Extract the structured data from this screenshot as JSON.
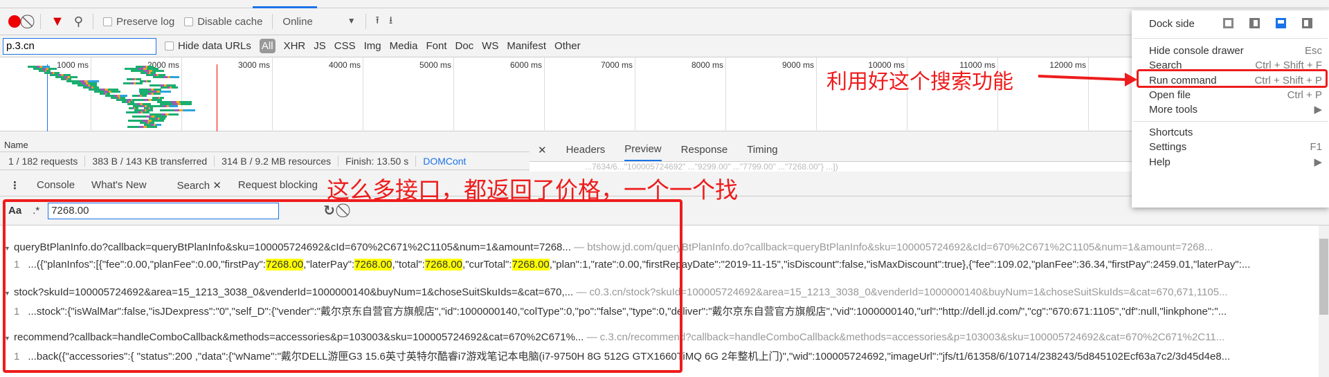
{
  "network_toolbar": {
    "preserve_log": "Preserve log",
    "disable_cache": "Disable cache",
    "throttle": "Online"
  },
  "filter": {
    "value": "p.3.cn",
    "hide_data_urls": "Hide data URLs",
    "types": [
      "All",
      "XHR",
      "JS",
      "CSS",
      "Img",
      "Media",
      "Font",
      "Doc",
      "WS",
      "Manifest",
      "Other"
    ]
  },
  "timeline": {
    "ticks": [
      "1000 ms",
      "2000 ms",
      "3000 ms",
      "4000 ms",
      "5000 ms",
      "6000 ms",
      "7000 ms",
      "8000 ms",
      "9000 ms",
      "10000 ms",
      "11000 ms",
      "12000 ms"
    ]
  },
  "requests": {
    "name_header": "Name"
  },
  "status": {
    "requests": "1 / 182 requests",
    "transferred": "383 B / 143 KB transferred",
    "resources": "314 B / 9.2 MB resources",
    "finish": "Finish: 13.50 s",
    "domcontent": "DOMCont"
  },
  "detail_tabs": {
    "headers": "Headers",
    "preview": "Preview",
    "response": "Response",
    "timing": "Timing"
  },
  "preview_text": "...7634/6...\"100005724692\"  ...\"9299.00\"  ...\"7799.00\"  ...\"7268.00\"}  ...])",
  "drawer_tabs": {
    "console": "Console",
    "whats_new": "What's New",
    "search": "Search",
    "request_blocking": "Request blocking"
  },
  "search": {
    "case_label": "Aa",
    "regex_label": ".*",
    "query": "7268.00"
  },
  "results": [
    {
      "file": "queryBtPlanInfo.do?callback=queryBtPlanInfo&sku=100005724692&cId=670%2C671%2C1105&num=1&amount=7268...",
      "url": "— btshow.jd.com/queryBtPlanInfo.do?callback=queryBtPlanInfo&sku=100005724692&cId=670%2C671%2C1105&num=1&amount=7268...",
      "line": "1",
      "parts": [
        "...({\"planInfos\":[{\"fee\":0.00,\"planFee\":0.00,\"firstPay\":",
        "7268.00",
        ",\"laterPay\":",
        "7268.00",
        ",\"total\":",
        "7268.00",
        ",\"curTotal\":",
        "7268.00",
        ",\"plan\":1,\"rate\":0.00,\"firstRepayDate\":\"2019-11-15\",\"isDiscount\":false,\"isMaxDiscount\":true},{\"fee\":109.02,\"planFee\":36.34,\"firstPay\":2459.01,\"laterPay\":..."
      ]
    },
    {
      "file": "stock?skuId=100005724692&area=15_1213_3038_0&venderId=1000000140&buyNum=1&choseSuitSkuIds=&cat=670,...",
      "url": "— c0.3.cn/stock?skuId=100005724692&area=15_1213_3038_0&venderId=1000000140&buyNum=1&choseSuitSkuIds=&cat=670,671,1105...",
      "line": "1",
      "parts": [
        "...stock\":{\"isWalMar\":false,\"isJDexpress\":\"0\",\"self_D\":{\"vender\":\"戴尔京东自营官方旗舰店\",\"id\":1000000140,\"colType\":0,\"po\":\"false\",\"type\":0,\"deliver\":\"戴尔京东自营官方旗舰店\",\"vid\":1000000140,\"url\":\"http://dell.jd.com/\",\"cg\":\"670:671:1105\",\"df\":null,\"linkphone\":\"..."
      ]
    },
    {
      "file": "recommend?callback=handleComboCallback&methods=accessories&p=103003&sku=100005724692&cat=670%2C671%...",
      "url": "— c.3.cn/recommend?callback=handleComboCallback&methods=accessories&p=103003&sku=100005724692&cat=670%2C671%2C11...",
      "line": "1",
      "parts": [
        "...back({\"accessories\":{  \"status\":200  ,\"data\":{\"wName\":\"戴尔DELL游匣G3 15.6英寸英特尔酷睿i7游戏笔记本电脑(i7-9750H 8G 512G GTX1660TiMQ 6G 2年整机上门)\",\"wid\":100005724692,\"imageUrl\":\"jfs/t1/61358/6/10714/238243/5d845102Ecf63a7c2/3d45d4e8..."
      ]
    }
  ],
  "menu": {
    "dock_side": "Dock side",
    "items": [
      {
        "label": "Hide console drawer",
        "shortcut": "Esc"
      },
      {
        "label": "Search",
        "shortcut": "Ctrl + Shift + F"
      },
      {
        "label": "Run command",
        "shortcut": "Ctrl + Shift + P"
      },
      {
        "label": "Open file",
        "shortcut": "Ctrl + P"
      },
      {
        "label": "More tools",
        "shortcut": "▶"
      },
      {
        "label": "Shortcuts",
        "shortcut": ""
      },
      {
        "label": "Settings",
        "shortcut": "F1"
      },
      {
        "label": "Help",
        "shortcut": "▶"
      }
    ]
  },
  "annotations": {
    "search_tip": "利用好这个搜索功能",
    "many_apis": "这么多接口，都返回了价格，一个一个找"
  },
  "colors": {
    "accent": "#1a73e8",
    "annotation": "#ee1c1c",
    "highlight": "#ffff00",
    "record": "#ee0000"
  }
}
